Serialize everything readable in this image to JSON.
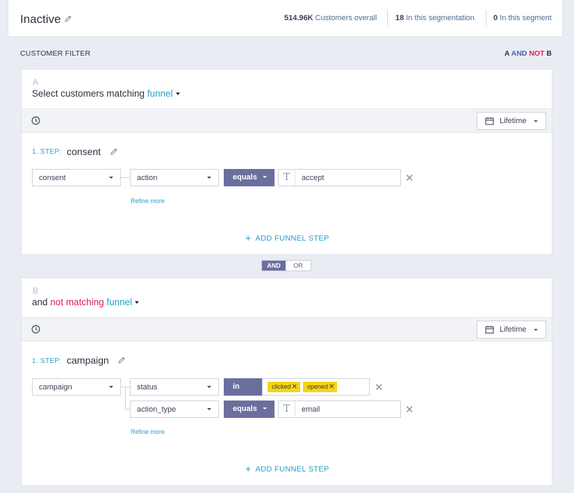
{
  "header": {
    "segment_name": "Inactive",
    "stats": [
      {
        "value": "514.96K",
        "label": "Customers overall"
      },
      {
        "value": "18",
        "label": "In this segmentation"
      },
      {
        "value": "0",
        "label": "In this segment"
      }
    ]
  },
  "filter": {
    "label": "CUSTOMER FILTER",
    "expression": {
      "a": "A",
      "and": "AND",
      "not": "NOT",
      "b": "B"
    }
  },
  "combinator": {
    "and": "AND",
    "or": "OR",
    "selected": "AND"
  },
  "cards": [
    {
      "letter": "A",
      "title_prefix": "Select customers matching",
      "title_link": "funnel",
      "time_range": "Lifetime",
      "step": {
        "label": "1. STEP:",
        "name": "consent",
        "event": "consent",
        "conditions": [
          {
            "property": "action",
            "operator": "equals",
            "value": "accept"
          }
        ]
      },
      "refine_more": "Refine more",
      "add_step": "ADD FUNNEL STEP"
    },
    {
      "letter": "B",
      "title_prefix": "and",
      "title_negation": "not matching",
      "title_link": "funnel",
      "time_range": "Lifetime",
      "step": {
        "label": "1. STEP:",
        "name": "campaign",
        "event": "campaign",
        "conditions": [
          {
            "property": "status",
            "operator": "in",
            "tags": [
              "clicked",
              "opened"
            ]
          },
          {
            "property": "action_type",
            "operator": "equals",
            "value": "email"
          }
        ]
      },
      "refine_more": "Refine more",
      "add_step": "ADD FUNNEL STEP"
    }
  ],
  "colors": {
    "accent_link": "#2a9fc9",
    "negation": "#d9225b",
    "operator_bg": "#6b6f9e",
    "tag_bg": "#f7d417",
    "page_bg": "#eaecf4"
  }
}
